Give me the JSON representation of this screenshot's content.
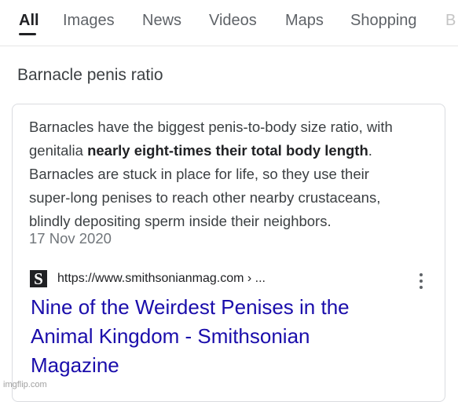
{
  "tabs": [
    {
      "label": "All"
    },
    {
      "label": "Images"
    },
    {
      "label": "News"
    },
    {
      "label": "Videos"
    },
    {
      "label": "Maps"
    },
    {
      "label": "Shopping"
    },
    {
      "label": "B"
    }
  ],
  "active_tab": "All",
  "query": "Barnacle penis ratio",
  "snippet": {
    "line1": "Barnacles have the biggest penis-to-body size ratio, with",
    "line2_pre": "genitalia ",
    "line2_bold": "nearly eight-times their total body length",
    "line2_post": ".",
    "line3": "Barnacles are stuck in place for life, so they use their",
    "line4": "super-long penises to reach other nearby crustaceans,",
    "line5": "blindly depositing sperm inside their neighbors.",
    "date": "17 Nov 2020"
  },
  "source": {
    "favicon_letter": "S",
    "url": "https://www.smithsonianmag.com › ..."
  },
  "result": {
    "title_line1": "Nine of the Weirdest Penises in the",
    "title_line2": "Animal Kingdom - Smithsonian",
    "title_line3": "Magazine"
  },
  "watermark": "imgflip.com",
  "colors": {
    "link": "#1a0dab",
    "tab_inactive": "#5f6368",
    "text": "#202124",
    "snippet_text": "#3c4043",
    "muted": "#70757a",
    "card_border": "#dadce0"
  },
  "icons": {
    "more": "more-vert-icon",
    "favicon": "smithsonian-favicon-icon"
  }
}
